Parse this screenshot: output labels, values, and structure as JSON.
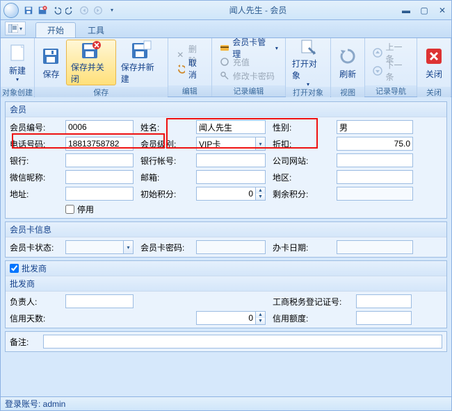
{
  "window": {
    "title": "闻人先生 - 会员"
  },
  "tabs": {
    "start": "开始",
    "tools": "工具"
  },
  "ribbon": {
    "new": "新建",
    "save": "保存",
    "save_close": "保存并关闭",
    "save_new": "保存并新建",
    "delete": "删除",
    "cancel": "取消",
    "card_mgmt": "会员卡管理",
    "recharge": "充值",
    "edit_pwd": "修改卡密码",
    "open_obj": "打开对象",
    "refresh": "刷新",
    "prev": "上一条",
    "next": "下一条",
    "close": "关闭",
    "group_create": "对象创建",
    "group_save": "保存",
    "group_edit": "编辑",
    "group_record": "记录编辑",
    "group_open": "打开对象",
    "group_view": "视图",
    "group_nav": "记录导航",
    "group_close": "关闭"
  },
  "panels": {
    "member": "会员",
    "card_info": "会员卡信息",
    "wholesaler": "批发商"
  },
  "labels": {
    "member_no": "会员编号:",
    "name": "姓名:",
    "gender": "性别:",
    "phone": "电话号码:",
    "level": "会员级别:",
    "discount": "折扣:",
    "bank": "银行:",
    "bank_acct": "银行帐号:",
    "website": "公司网站:",
    "wechat": "微信昵称:",
    "email": "邮箱:",
    "region": "地区:",
    "address": "地址:",
    "init_pts": "初始积分:",
    "rem_pts": "剩余积分:",
    "disabled": "停用",
    "card_status": "会员卡状态:",
    "card_pwd": "会员卡密码:",
    "open_date": "办卡日期:",
    "manager": "负责人:",
    "tax_reg": "工商税务登记证号:",
    "credit_days": "信用天数:",
    "credit_limit": "信用额度:",
    "remark": "备注:"
  },
  "values": {
    "member_no": "0006",
    "name": "闻人先生",
    "gender": "男",
    "phone": "18813758782",
    "level": "VIP卡",
    "discount": "75.0",
    "init_pts": "0",
    "credit_days": "0"
  },
  "status": {
    "login": "登录账号: admin"
  }
}
